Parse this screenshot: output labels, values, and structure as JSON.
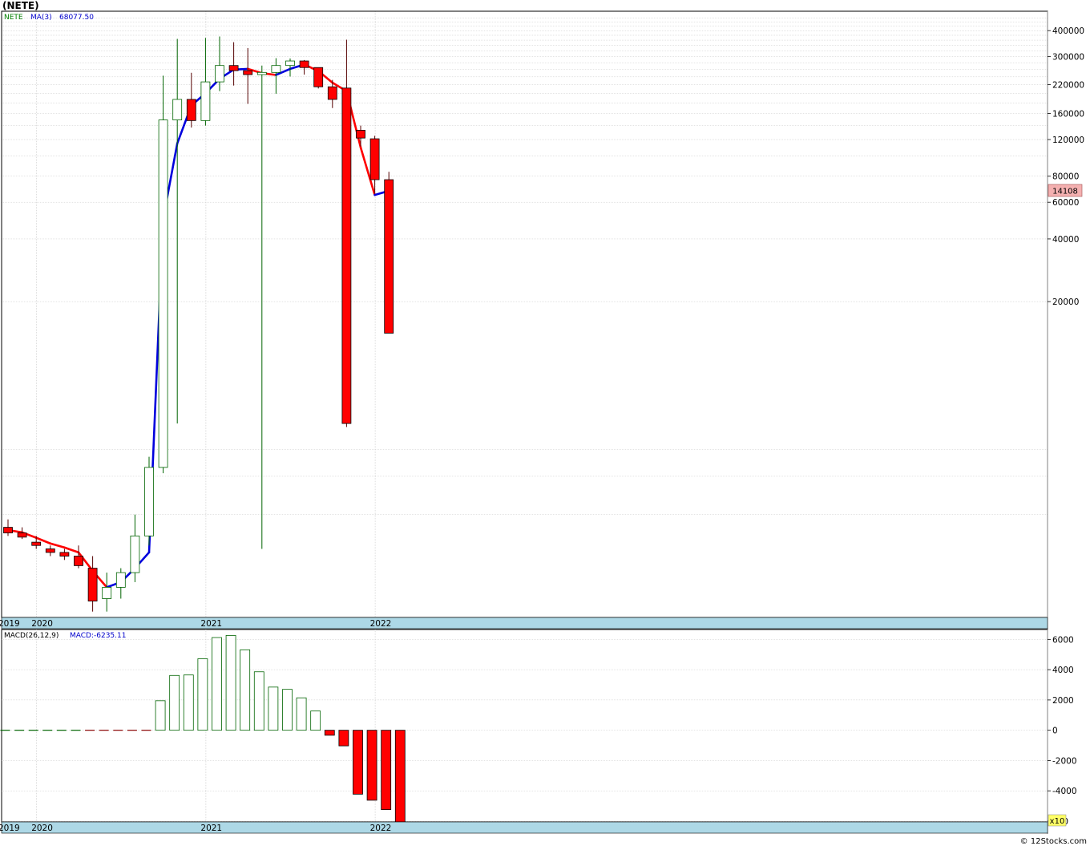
{
  "title": "(NETE)",
  "footer": "© 12Stocks.com",
  "price_pane": {
    "legend_symbol": "NETE",
    "legend_ma_label": "MA(3)",
    "legend_ma_value": "68077.50",
    "last_price_label": "14108",
    "y_tick_labels": [
      "400000",
      "300000",
      "220000",
      "160000",
      "120000",
      "80000",
      "60000",
      "40000",
      "20000"
    ],
    "x_labels": [
      "2019",
      "2020",
      "2021",
      "2022"
    ]
  },
  "macd_pane": {
    "legend_name": "MACD(26,12,9)",
    "legend_value": "MACD:-6235.11",
    "y_tick_labels": [
      "6000",
      "4000",
      "2000",
      "0",
      "-2000",
      "-4000",
      "000"
    ],
    "scale_badge": "x10",
    "x_labels": [
      "2019",
      "2020",
      "2021",
      "2022"
    ]
  },
  "colors": {
    "up_candle": "#006400",
    "down_candle": "#ff0000",
    "ma_up": "#0000dd",
    "ma_down": "#ff0000",
    "axis_band": "#add8e6",
    "grid": "#c8c8c8",
    "legend_symbol": "#008000",
    "legend_ma": "#0000cc",
    "last_price_bg": "#f4b0b0"
  },
  "chart_data": [
    {
      "type": "candlestick",
      "scale": "log",
      "x": [
        "2019-11",
        "2019-12",
        "2020-01",
        "2020-02",
        "2020-03",
        "2020-04",
        "2020-05",
        "2020-06",
        "2020-07",
        "2020-08",
        "2020-09",
        "2020-10",
        "2020-11",
        "2020-12",
        "2021-01",
        "2021-02",
        "2021-03",
        "2021-04",
        "2021-05",
        "2021-06",
        "2021-07",
        "2021-08",
        "2021-09",
        "2021-10",
        "2021-11",
        "2021-12",
        "2022-01",
        "2022-02"
      ],
      "open": [
        1650,
        1550,
        1400,
        1300,
        1250,
        1200,
        1050,
        750,
        850,
        1000,
        1500,
        3200,
        149000,
        187000,
        148000,
        227000,
        272000,
        257000,
        246000,
        252000,
        272000,
        286000,
        266000,
        215000,
        212000,
        133000,
        121000,
        77000
      ],
      "high": [
        1800,
        1650,
        1500,
        1350,
        1300,
        1350,
        1200,
        1000,
        1050,
        1900,
        3600,
        243000,
        365000,
        251000,
        369000,
        375000,
        352000,
        330000,
        272000,
        295000,
        294000,
        289000,
        266000,
        232000,
        362000,
        140000,
        125000,
        84000
      ],
      "low": [
        1500,
        1450,
        1300,
        1200,
        1150,
        1050,
        650,
        650,
        750,
        900,
        1350,
        3000,
        5200,
        137000,
        140000,
        205000,
        218000,
        178000,
        1300,
        199000,
        241000,
        246000,
        211000,
        170000,
        5000,
        111000,
        66000,
        15000
      ],
      "close": [
        1550,
        1480,
        1350,
        1250,
        1200,
        1080,
        730,
        850,
        1000,
        1500,
        3200,
        149000,
        187000,
        148000,
        227000,
        272000,
        257000,
        246000,
        252000,
        272000,
        286000,
        266000,
        215000,
        187000,
        5200,
        122000,
        77000,
        14108
      ],
      "ma_line": {
        "name": "MA(3)",
        "values": [
          1600,
          1560,
          1470,
          1380,
          1320,
          1250,
          1020,
          850,
          900,
          1050,
          1250,
          50000,
          115000,
          175000,
          200000,
          235000,
          260000,
          262000,
          250000,
          245000,
          262000,
          275000,
          256000,
          225000,
          205000,
          110000,
          65000,
          68077.5
        ]
      },
      "ylim": [
        620,
        470000
      ],
      "y_ticks": [
        400000,
        300000,
        220000,
        160000,
        120000,
        80000,
        60000,
        40000,
        20000
      ],
      "last_price": 14108
    },
    {
      "type": "bar",
      "x": [
        "2019-11",
        "2019-12",
        "2020-01",
        "2020-02",
        "2020-03",
        "2020-04",
        "2020-05",
        "2020-06",
        "2020-07",
        "2020-08",
        "2020-09",
        "2020-10",
        "2020-11",
        "2020-12",
        "2021-01",
        "2021-02",
        "2021-03",
        "2021-04",
        "2021-05",
        "2021-06",
        "2021-07",
        "2021-08",
        "2021-09",
        "2021-10",
        "2021-11",
        "2021-12",
        "2022-01",
        "2022-02"
      ],
      "values": [
        0,
        0,
        0,
        0,
        0,
        0,
        0,
        0,
        0,
        0,
        0,
        1950,
        3620,
        3650,
        4720,
        6120,
        6260,
        5310,
        3860,
        2850,
        2700,
        2140,
        1270,
        -330,
        -1030,
        -4220,
        -4620,
        -5240,
        -6235.11
      ],
      "ylim": [
        -6000,
        6600
      ],
      "y_ticks": [
        6000,
        4000,
        2000,
        0,
        -2000,
        -4000,
        -6000
      ],
      "units_multiplier": "x10",
      "grid": true
    }
  ]
}
